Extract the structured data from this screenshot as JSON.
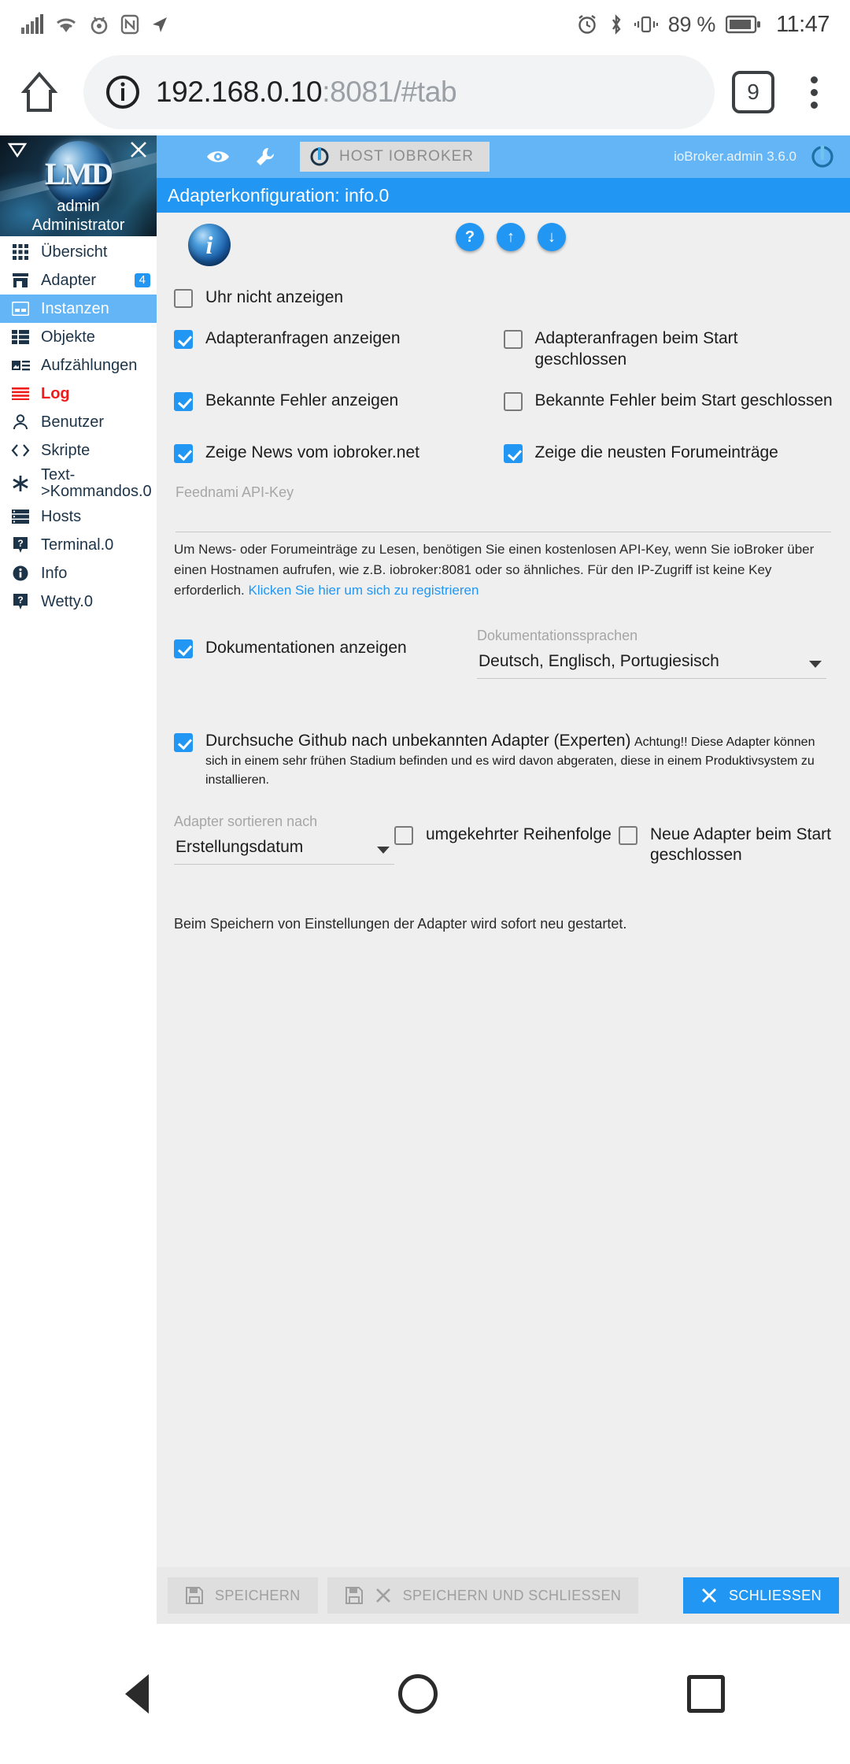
{
  "status_bar": {
    "battery_percent": "89 %",
    "clock": "11:47",
    "icons": [
      "signal-icon",
      "wifi-icon",
      "eye-care-icon",
      "nfc-icon",
      "location-icon",
      "alarm-icon",
      "bluetooth-icon",
      "vibrate-icon",
      "battery-icon"
    ]
  },
  "browser": {
    "url_host": "192.168.0.10",
    "url_rest": ":8081/#tab",
    "tab_count": "9",
    "home_label": "Home",
    "menu_label": "More options"
  },
  "sidebar": {
    "user": "admin",
    "role": "Administrator",
    "logo_text": "LMD",
    "items": [
      {
        "label": "Übersicht",
        "icon": "grid-icon",
        "selected": false,
        "alert": false,
        "badge": ""
      },
      {
        "label": "Adapter",
        "icon": "store-icon",
        "selected": false,
        "alert": false,
        "badge": "4"
      },
      {
        "label": "Instanzen",
        "icon": "instances-icon",
        "selected": true,
        "alert": false,
        "badge": ""
      },
      {
        "label": "Objekte",
        "icon": "list-table-icon",
        "selected": false,
        "alert": false,
        "badge": ""
      },
      {
        "label": "Aufzählungen",
        "icon": "enum-icon",
        "selected": false,
        "alert": false,
        "badge": ""
      },
      {
        "label": "Log",
        "icon": "log-lines-icon",
        "selected": false,
        "alert": true,
        "badge": ""
      },
      {
        "label": "Benutzer",
        "icon": "user-icon",
        "selected": false,
        "alert": false,
        "badge": ""
      },
      {
        "label": "Skripte",
        "icon": "code-icon",
        "selected": false,
        "alert": false,
        "badge": ""
      },
      {
        "label": "Text->Kommandos.0",
        "icon": "asterisk-icon",
        "selected": false,
        "alert": false,
        "badge": ""
      },
      {
        "label": "Hosts",
        "icon": "server-icon",
        "selected": false,
        "alert": false,
        "badge": ""
      },
      {
        "label": "Terminal.0",
        "icon": "question-icon",
        "selected": false,
        "alert": false,
        "badge": ""
      },
      {
        "label": "Info",
        "icon": "info-circle-icon",
        "selected": false,
        "alert": false,
        "badge": ""
      },
      {
        "label": "Wetty.0",
        "icon": "question-icon",
        "selected": false,
        "alert": false,
        "badge": ""
      }
    ]
  },
  "toolbar": {
    "host_chip_label": "HOST IOBROKER",
    "version": "ioBroker.admin 3.6.0",
    "eye_tooltip": "Ansicht",
    "wrench_tooltip": "Einstellungen"
  },
  "title_bar": {
    "title": "Adapterkonfiguration: info.0"
  },
  "round_buttons": {
    "help": "?",
    "upload": "↑",
    "download": "↓"
  },
  "form": {
    "cb_hide_clock": {
      "label": "Uhr nicht anzeigen",
      "checked": false
    },
    "cb_show_requests": {
      "label": "Adapteranfragen anzeigen",
      "checked": true
    },
    "cb_requests_closed": {
      "label": "Adapteranfragen beim Start geschlossen",
      "checked": false
    },
    "cb_show_known_errors": {
      "label": "Bekannte Fehler anzeigen",
      "checked": true
    },
    "cb_errors_closed": {
      "label": "Bekannte Fehler beim Start geschlossen",
      "checked": false
    },
    "cb_show_news": {
      "label": "Zeige News vom iobroker.net",
      "checked": true
    },
    "cb_show_forum": {
      "label": "Zeige die neusten Forumeinträge",
      "checked": true
    },
    "apikey_label": "Feednami API-Key",
    "apikey_value": "",
    "help_text_1": "Um News- oder Forumeinträge zu Lesen, benötigen Sie einen kostenlosen API-Key, wenn Sie ioBroker über einen Hostnamen aufrufen, wie z.B. iobroker:8081 oder so ähnliches. Für den IP-Zugriff ist keine Key erforderlich.",
    "help_link": "Klicken Sie hier um sich zu registrieren",
    "cb_show_docs": {
      "label": "Dokumentationen anzeigen",
      "checked": true
    },
    "docs_lang_label": "Dokumentationssprachen",
    "docs_lang_value": "Deutsch, Englisch, Portugiesisch",
    "cb_github": {
      "label": "Durchsuche Github nach unbekannten Adapter (Experten)",
      "checked": true
    },
    "github_warning": "Achtung!! Diese Adapter können sich in einem sehr frühen Stadium befinden und es wird davon abgeraten, diese in einem Produktivsystem zu installieren.",
    "sort_label": "Adapter sortieren nach",
    "sort_value": "Erstellungsdatum",
    "cb_reverse": {
      "label": "umgekehrter Reihenfolge",
      "checked": false
    },
    "cb_new_closed": {
      "label": "Neue Adapter beim Start geschlossen",
      "checked": false
    },
    "restart_note": "Beim Speichern von Einstellungen der Adapter wird sofort neu gestartet."
  },
  "footer": {
    "save": "SPEICHERN",
    "save_close": "SPEICHERN UND SCHLIESSEN",
    "close": "SCHLIESSEN"
  },
  "navbar": {
    "back": "Zurück",
    "home": "Startseite",
    "recents": "Übersicht"
  }
}
